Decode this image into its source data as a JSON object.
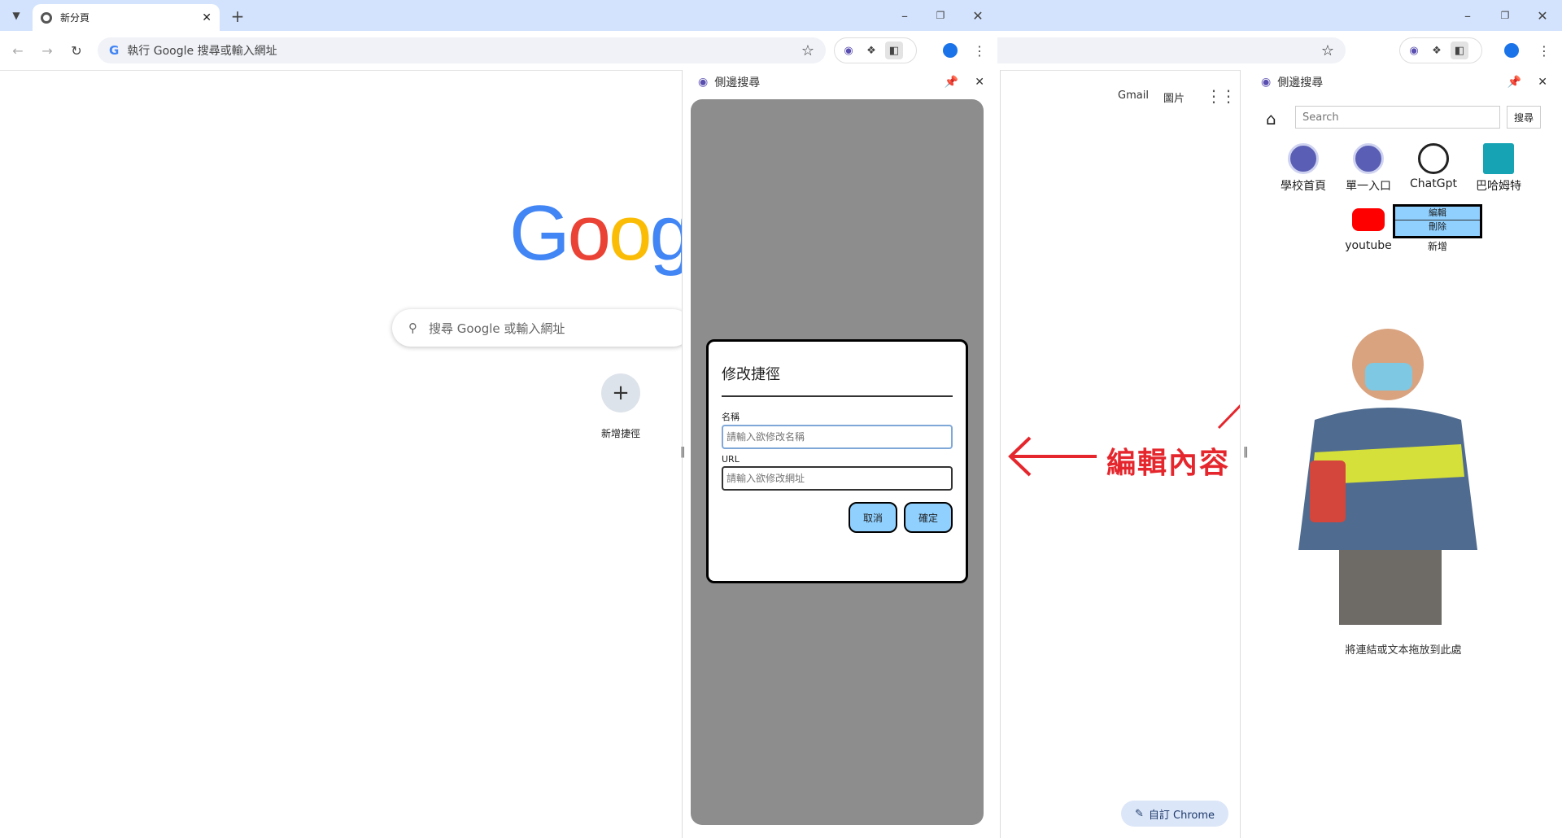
{
  "browser": {
    "tab_title": "新分頁",
    "omnibox_placeholder": "執行 Google 搜尋或輸入網址"
  },
  "newtab": {
    "links": {
      "gmail": "Gmail",
      "images": "圖片"
    },
    "search_placeholder": "搜尋 Google 或輸入網址",
    "add_shortcut_label": "新增捷徑",
    "customize_label": "自訂 Chrome"
  },
  "side_panel_left": {
    "title": "側邊搜尋",
    "dialog": {
      "title": "修改捷徑",
      "name_label": "名稱",
      "name_placeholder": "請輸入欲修改名稱",
      "url_label": "URL",
      "url_placeholder": "請輸入欲修改網址",
      "cancel": "取消",
      "confirm": "確定"
    }
  },
  "annotation": {
    "text": "編輯內容",
    "color": "#e5262d"
  },
  "side_panel_right": {
    "title": "側邊搜尋",
    "search_placeholder": "Search",
    "search_button": "搜尋",
    "shortcuts": [
      {
        "label": "學校首頁",
        "icon": "school-logo-icon"
      },
      {
        "label": "單一入口",
        "icon": "school-logo-icon"
      },
      {
        "label": "ChatGpt",
        "icon": "chatgpt-icon"
      },
      {
        "label": "巴哈姆特",
        "icon": "bahamut-icon"
      },
      {
        "label": "youtube",
        "icon": "youtube-icon"
      }
    ],
    "context_menu": {
      "edit": "編輯",
      "delete": "刪除"
    },
    "add_label": "新增",
    "drop_hint": "將連結或文本拖放到此處"
  }
}
